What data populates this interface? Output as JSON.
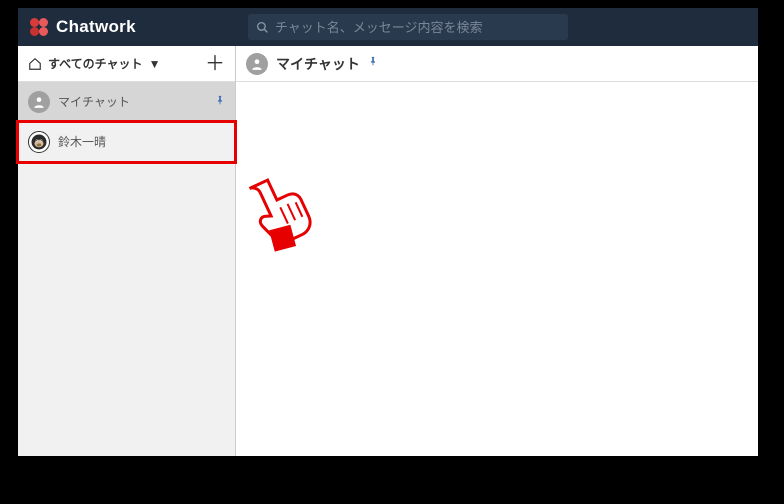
{
  "header": {
    "brand": "Chatwork",
    "search_placeholder": "チャット名、メッセージ内容を検索"
  },
  "sidebar": {
    "filter_label": "すべてのチャット",
    "items": [
      {
        "label": "マイチャット",
        "avatar": "gray-user",
        "pinned": true,
        "selected": true
      },
      {
        "label": "鈴木一晴",
        "avatar": "gorilla",
        "pinned": false,
        "selected": false,
        "highlighted": true
      }
    ]
  },
  "main": {
    "title": "マイチャット",
    "pinned": true
  },
  "colors": {
    "header_bg": "#1f2c3d",
    "accent_red": "#e60000",
    "pin_blue": "#3e6fb0"
  }
}
